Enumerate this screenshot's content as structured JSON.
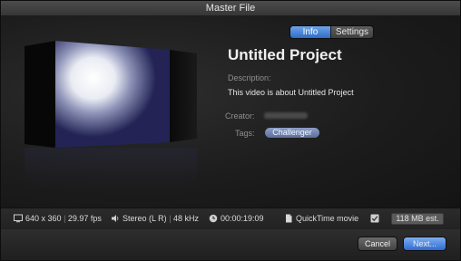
{
  "window": {
    "title": "Master File"
  },
  "tabs": [
    {
      "label": "Info",
      "selected": true
    },
    {
      "label": "Settings",
      "selected": false
    }
  ],
  "project": {
    "title": "Untitled Project",
    "description_label": "Description:",
    "description": "This video is about Untitled Project",
    "creator_label": "Creator:",
    "tags_label": "Tags:",
    "tags": [
      "Challenger"
    ]
  },
  "info_strip": {
    "resolution": "640 x 360",
    "fps": "29.97 fps",
    "audio": "Stereo (L R)",
    "sample_rate": "48 kHz",
    "duration": "00:00:19:09",
    "format": "QuickTime movie",
    "size": "118 MB est."
  },
  "buttons": {
    "cancel": "Cancel",
    "next": "Next..."
  },
  "colors": {
    "accent": "#3a78d8",
    "tag": "#6f82ad",
    "background": "#1b1b1b"
  }
}
